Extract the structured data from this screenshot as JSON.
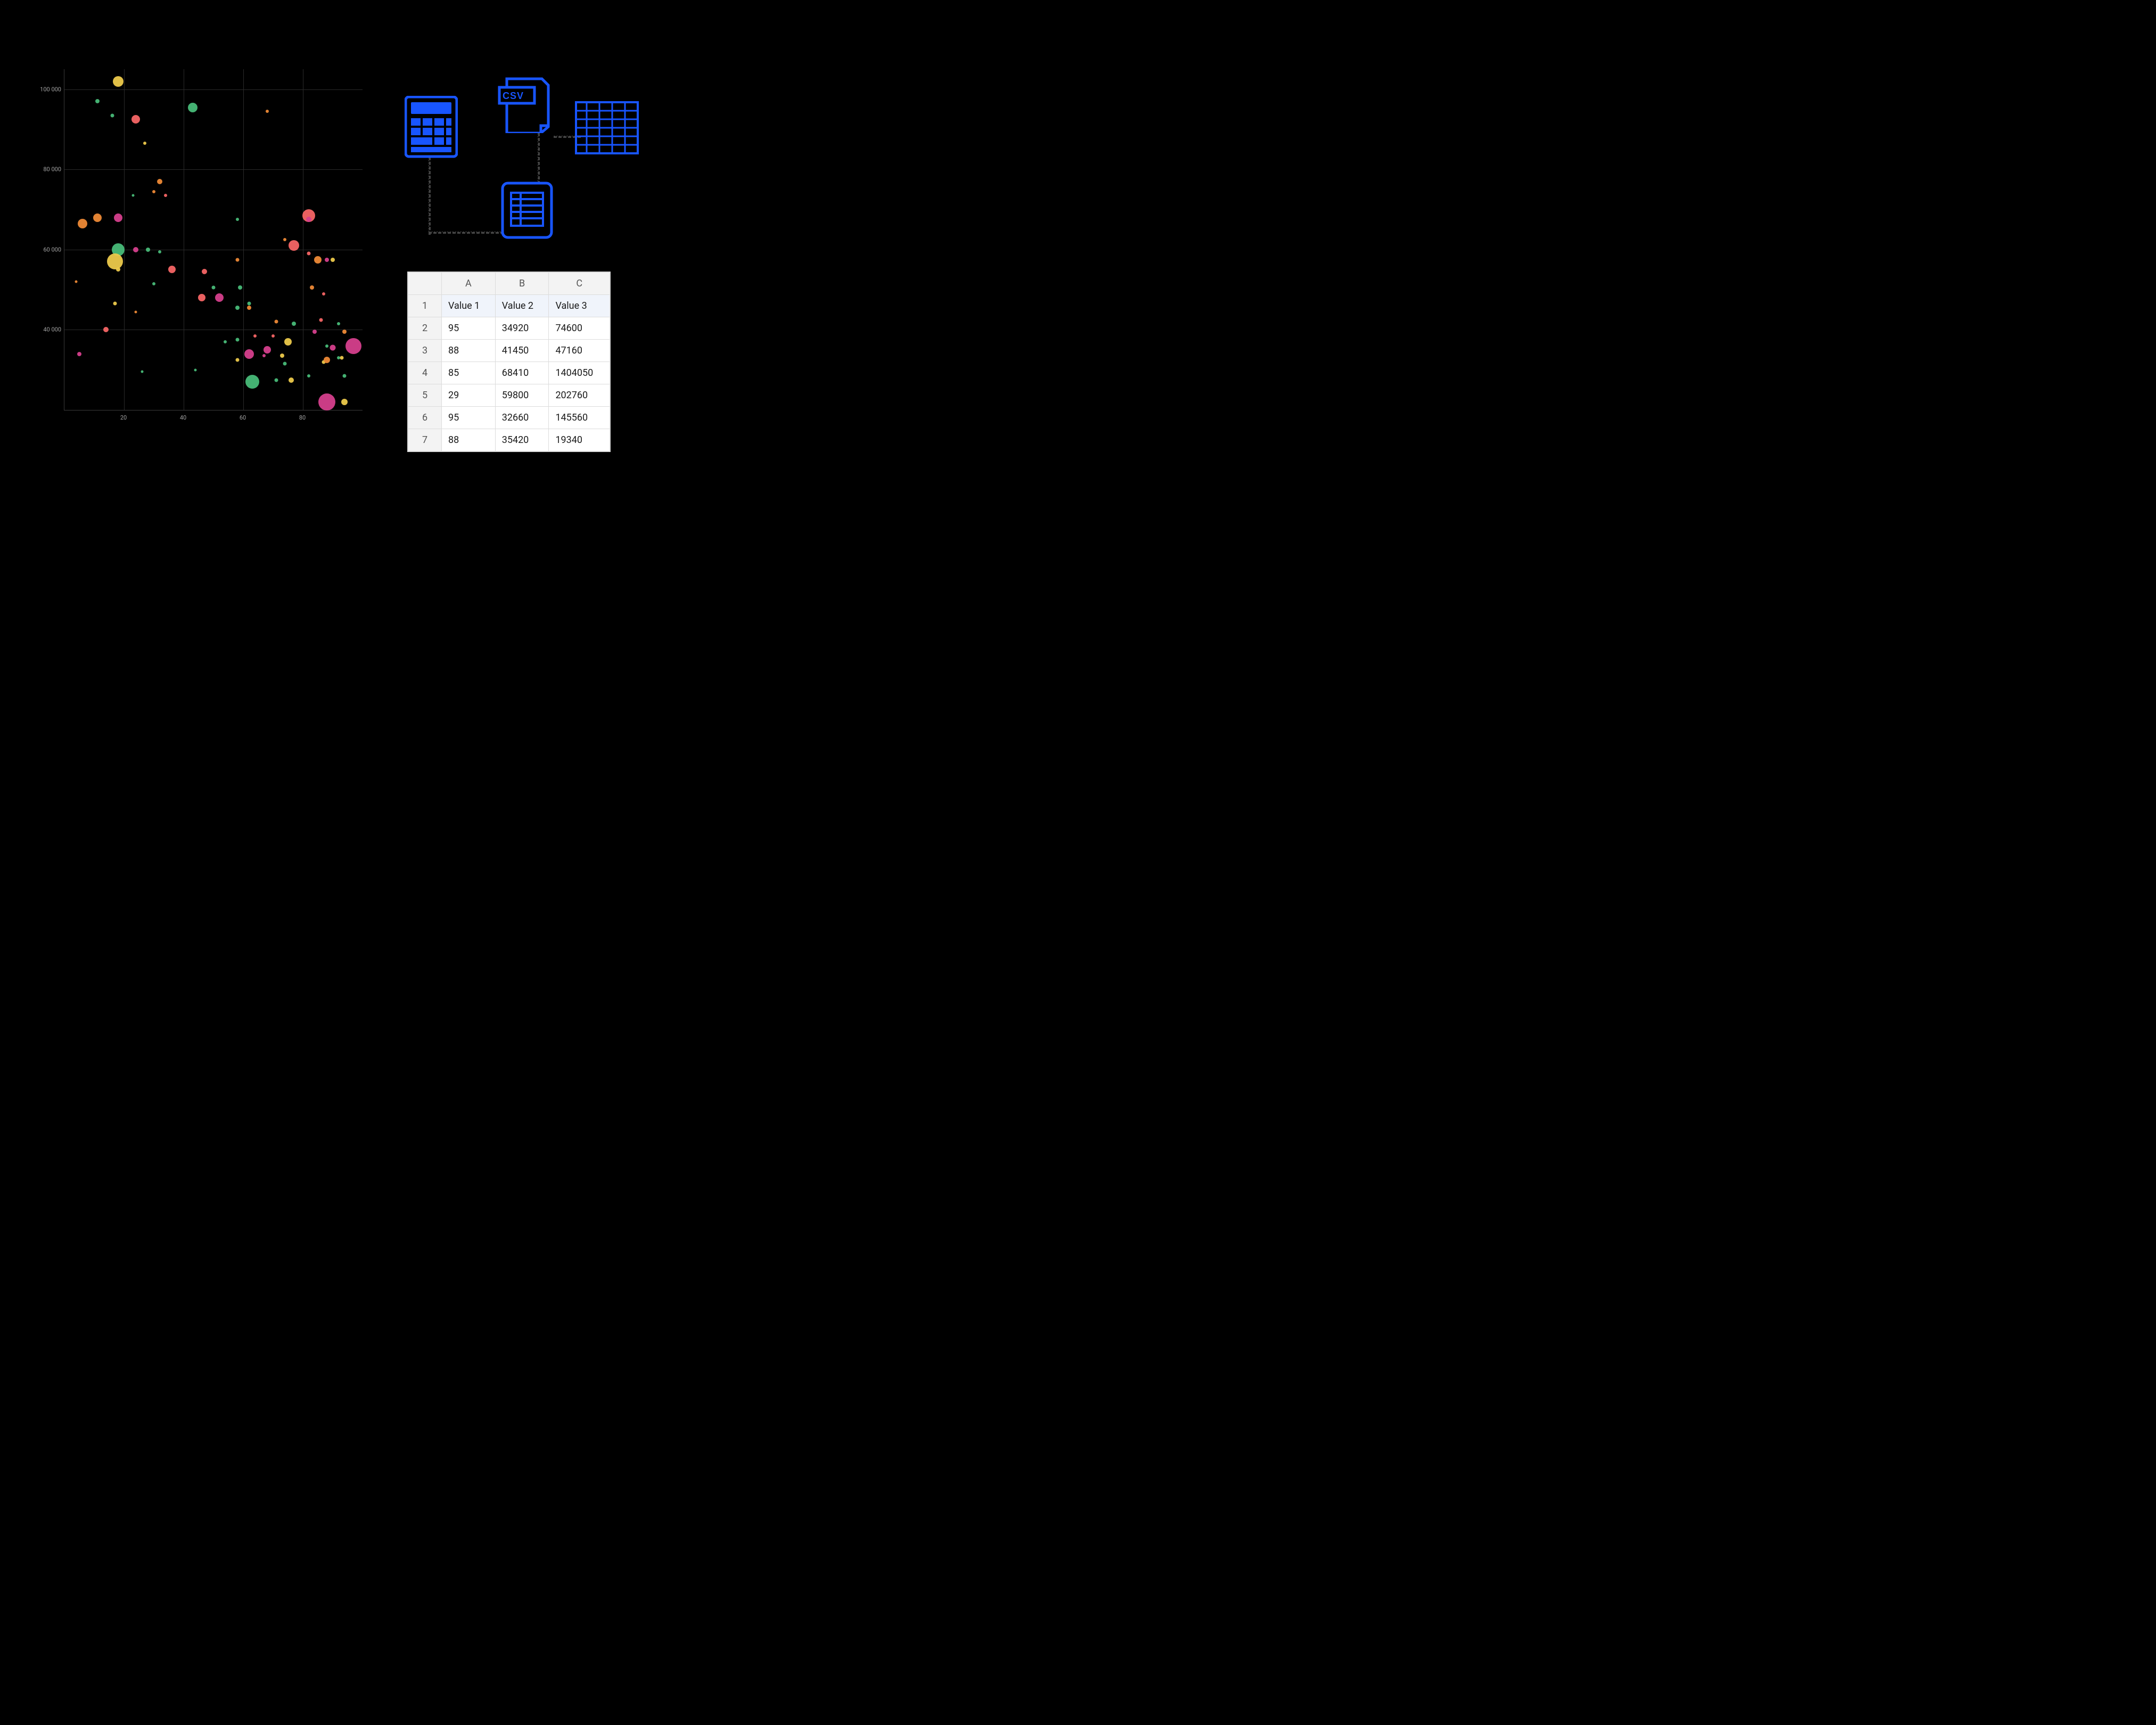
{
  "colors": {
    "accent_blue": "#1855ff",
    "green": "#48BB78",
    "orange": "#ED8936",
    "pink": "#D53F8C",
    "yellow": "#ECC94B",
    "red": "#F56565",
    "crimson": "#E53E3E"
  },
  "chart_data": {
    "type": "scatter",
    "title": "",
    "xlabel": "",
    "ylabel": "",
    "xlim": [
      0,
      100
    ],
    "ylim": [
      20000,
      105000
    ],
    "x_ticks": [
      20,
      40,
      60,
      80
    ],
    "y_ticks": [
      "40 000",
      "60 000",
      "80 000",
      "100 000"
    ],
    "points": [
      {
        "x": 18,
        "y": 102000,
        "size": 20,
        "color": "#ECC94B"
      },
      {
        "x": 11,
        "y": 97000,
        "size": 8,
        "color": "#48BB78"
      },
      {
        "x": 16,
        "y": 93500,
        "size": 7,
        "color": "#48BB78"
      },
      {
        "x": 43,
        "y": 95500,
        "size": 18,
        "color": "#48BB78"
      },
      {
        "x": 68,
        "y": 94500,
        "size": 6,
        "color": "#ED8936"
      },
      {
        "x": 24,
        "y": 92500,
        "size": 16,
        "color": "#F56565"
      },
      {
        "x": 27,
        "y": 86500,
        "size": 6,
        "color": "#ECC94B"
      },
      {
        "x": 32,
        "y": 77000,
        "size": 10,
        "color": "#ED8936"
      },
      {
        "x": 30,
        "y": 74500,
        "size": 6,
        "color": "#ED8936"
      },
      {
        "x": 34,
        "y": 73500,
        "size": 6,
        "color": "#F56565"
      },
      {
        "x": 23,
        "y": 73500,
        "size": 5,
        "color": "#48BB78"
      },
      {
        "x": 11,
        "y": 68000,
        "size": 16,
        "color": "#ED8936"
      },
      {
        "x": 18,
        "y": 68000,
        "size": 16,
        "color": "#D53F8C"
      },
      {
        "x": 6,
        "y": 66500,
        "size": 18,
        "color": "#ED8936"
      },
      {
        "x": 58,
        "y": 67500,
        "size": 6,
        "color": "#48BB78"
      },
      {
        "x": 82,
        "y": 68500,
        "size": 24,
        "color": "#F56565"
      },
      {
        "x": 82,
        "y": 67500,
        "size": 10,
        "color": "#D53F8C"
      },
      {
        "x": 74,
        "y": 62500,
        "size": 6,
        "color": "#ED8936"
      },
      {
        "x": 77,
        "y": 61000,
        "size": 20,
        "color": "#F56565"
      },
      {
        "x": 18,
        "y": 60000,
        "size": 24,
        "color": "#48BB78"
      },
      {
        "x": 24,
        "y": 60000,
        "size": 10,
        "color": "#D53F8C"
      },
      {
        "x": 28,
        "y": 60000,
        "size": 8,
        "color": "#48BB78"
      },
      {
        "x": 32,
        "y": 59500,
        "size": 6,
        "color": "#48BB78"
      },
      {
        "x": 58,
        "y": 57500,
        "size": 7,
        "color": "#ED8936"
      },
      {
        "x": 82,
        "y": 59000,
        "size": 7,
        "color": "#F56565"
      },
      {
        "x": 85,
        "y": 57500,
        "size": 14,
        "color": "#ED8936"
      },
      {
        "x": 88,
        "y": 57500,
        "size": 8,
        "color": "#D53F8C"
      },
      {
        "x": 90,
        "y": 57500,
        "size": 8,
        "color": "#ECC94B"
      },
      {
        "x": 17,
        "y": 57000,
        "size": 30,
        "color": "#ECC94B"
      },
      {
        "x": 18,
        "y": 55000,
        "size": 8,
        "color": "#ECC94B"
      },
      {
        "x": 36,
        "y": 55000,
        "size": 14,
        "color": "#F56565"
      },
      {
        "x": 47,
        "y": 54500,
        "size": 10,
        "color": "#F56565"
      },
      {
        "x": 4,
        "y": 52000,
        "size": 5,
        "color": "#ED8936"
      },
      {
        "x": 30,
        "y": 51500,
        "size": 6,
        "color": "#48BB78"
      },
      {
        "x": 50,
        "y": 50500,
        "size": 7,
        "color": "#48BB78"
      },
      {
        "x": 46,
        "y": 48000,
        "size": 14,
        "color": "#F56565"
      },
      {
        "x": 52,
        "y": 48000,
        "size": 16,
        "color": "#D53F8C"
      },
      {
        "x": 59,
        "y": 50500,
        "size": 8,
        "color": "#48BB78"
      },
      {
        "x": 83,
        "y": 50500,
        "size": 8,
        "color": "#ED8936"
      },
      {
        "x": 87,
        "y": 49000,
        "size": 6,
        "color": "#F56565"
      },
      {
        "x": 58,
        "y": 45500,
        "size": 8,
        "color": "#48BB78"
      },
      {
        "x": 62,
        "y": 46500,
        "size": 7,
        "color": "#48BB78"
      },
      {
        "x": 62,
        "y": 45500,
        "size": 8,
        "color": "#ED8936"
      },
      {
        "x": 17,
        "y": 46500,
        "size": 7,
        "color": "#ECC94B"
      },
      {
        "x": 24,
        "y": 44500,
        "size": 5,
        "color": "#ED8936"
      },
      {
        "x": 71,
        "y": 42000,
        "size": 7,
        "color": "#ED8936"
      },
      {
        "x": 77,
        "y": 41500,
        "size": 8,
        "color": "#48BB78"
      },
      {
        "x": 86,
        "y": 42500,
        "size": 7,
        "color": "#F56565"
      },
      {
        "x": 92,
        "y": 41500,
        "size": 6,
        "color": "#48BB78"
      },
      {
        "x": 14,
        "y": 40000,
        "size": 10,
        "color": "#F56565"
      },
      {
        "x": 58,
        "y": 37500,
        "size": 7,
        "color": "#48BB78"
      },
      {
        "x": 54,
        "y": 37000,
        "size": 6,
        "color": "#48BB78"
      },
      {
        "x": 64,
        "y": 38500,
        "size": 6,
        "color": "#F56565"
      },
      {
        "x": 70,
        "y": 38500,
        "size": 6,
        "color": "#F56565"
      },
      {
        "x": 75,
        "y": 37000,
        "size": 14,
        "color": "#ECC94B"
      },
      {
        "x": 84,
        "y": 39500,
        "size": 8,
        "color": "#D53F8C"
      },
      {
        "x": 94,
        "y": 39500,
        "size": 8,
        "color": "#ED8936"
      },
      {
        "x": 97,
        "y": 36000,
        "size": 30,
        "color": "#D53F8C"
      },
      {
        "x": 90,
        "y": 35500,
        "size": 11,
        "color": "#D53F8C"
      },
      {
        "x": 88,
        "y": 36000,
        "size": 6,
        "color": "#48BB78"
      },
      {
        "x": 92,
        "y": 33000,
        "size": 6,
        "color": "#48BB78"
      },
      {
        "x": 68,
        "y": 35000,
        "size": 14,
        "color": "#D53F8C"
      },
      {
        "x": 62,
        "y": 34000,
        "size": 18,
        "color": "#D53F8C"
      },
      {
        "x": 67,
        "y": 33500,
        "size": 6,
        "color": "#D53F8C"
      },
      {
        "x": 73,
        "y": 33500,
        "size": 8,
        "color": "#ECC94B"
      },
      {
        "x": 74,
        "y": 31500,
        "size": 7,
        "color": "#48BB78"
      },
      {
        "x": 87,
        "y": 32000,
        "size": 7,
        "color": "#ECC94B"
      },
      {
        "x": 88,
        "y": 32500,
        "size": 12,
        "color": "#ED8936"
      },
      {
        "x": 93,
        "y": 33000,
        "size": 7,
        "color": "#ECC94B"
      },
      {
        "x": 5,
        "y": 34000,
        "size": 8,
        "color": "#D53F8C"
      },
      {
        "x": 58,
        "y": 32500,
        "size": 7,
        "color": "#ECC94B"
      },
      {
        "x": 26,
        "y": 29500,
        "size": 5,
        "color": "#48BB78"
      },
      {
        "x": 44,
        "y": 30000,
        "size": 5,
        "color": "#48BB78"
      },
      {
        "x": 63,
        "y": 27000,
        "size": 26,
        "color": "#48BB78"
      },
      {
        "x": 71,
        "y": 27500,
        "size": 7,
        "color": "#48BB78"
      },
      {
        "x": 76,
        "y": 27500,
        "size": 10,
        "color": "#ECC94B"
      },
      {
        "x": 82,
        "y": 28500,
        "size": 6,
        "color": "#48BB78"
      },
      {
        "x": 94,
        "y": 28500,
        "size": 7,
        "color": "#48BB78"
      },
      {
        "x": 88,
        "y": 22000,
        "size": 32,
        "color": "#D53F8C"
      },
      {
        "x": 94,
        "y": 22000,
        "size": 12,
        "color": "#ECC94B"
      }
    ]
  },
  "icons": {
    "csv_label": "CSV"
  },
  "table": {
    "columns_letters": [
      "A",
      "B",
      "C"
    ],
    "header_row": [
      "Value 1",
      "Value 2",
      "Value 3"
    ],
    "row_numbers": [
      "1",
      "2",
      "3",
      "4",
      "5",
      "6",
      "7"
    ],
    "rows": [
      [
        "95",
        "34920",
        "74600"
      ],
      [
        "88",
        "41450",
        "47160"
      ],
      [
        "85",
        "68410",
        "1404050"
      ],
      [
        "29",
        "59800",
        "202760"
      ],
      [
        "95",
        "32660",
        "145560"
      ],
      [
        "88",
        "35420",
        "19340"
      ]
    ]
  }
}
